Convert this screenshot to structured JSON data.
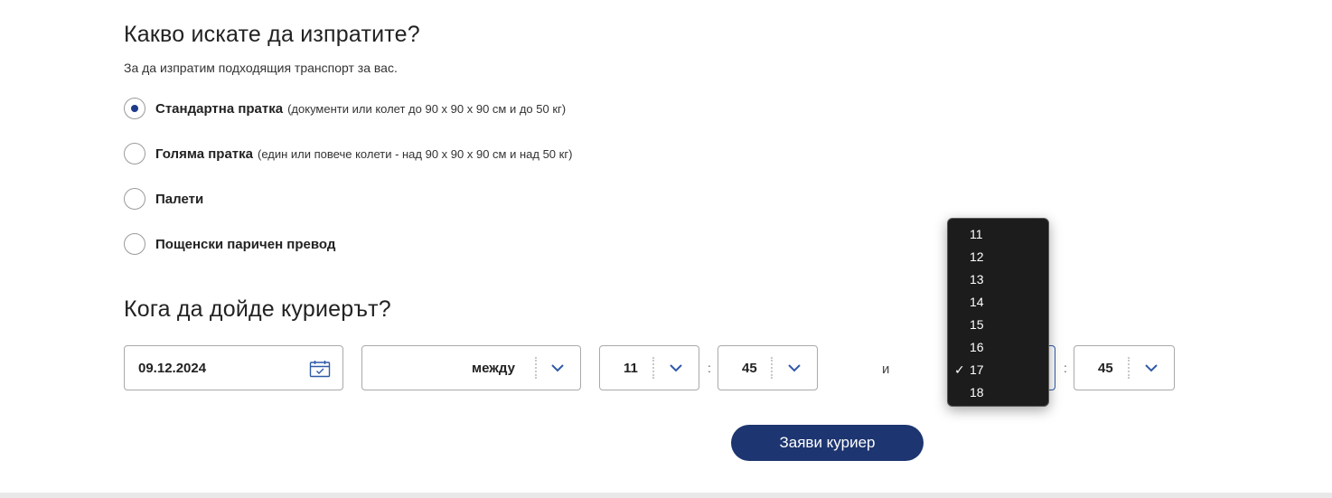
{
  "shipment": {
    "title": "Какво искате да изпратите?",
    "subtitle": "За да изпратим подходящия транспорт за вас.",
    "options": [
      {
        "label": "Стандартна пратка",
        "hint": "(документи или колет до 90 х 90 х 90 см и до 50 кг)",
        "selected": true
      },
      {
        "label": "Голяма пратка",
        "hint": "(един или повече колети - над 90 х 90 х 90 см и над 50 кг)",
        "selected": false
      },
      {
        "label": "Палети",
        "hint": "",
        "selected": false
      },
      {
        "label": "Пощенски паричен превод",
        "hint": "",
        "selected": false
      }
    ]
  },
  "courier": {
    "title": "Кога да дойде куриерът?",
    "date": "09.12.2024",
    "range_mode": "между",
    "from_hour": "11",
    "from_minute": "45",
    "and_label": "и",
    "to_minute": "45",
    "submit_label": "Заяви куриер"
  },
  "hour_dropdown": {
    "options": [
      "11",
      "12",
      "13",
      "14",
      "15",
      "16",
      "17",
      "18"
    ],
    "selected": "17",
    "check_glyph": "✓"
  },
  "colors": {
    "accent": "#1e3a8a",
    "button": "#1d3570",
    "dropdown_bg": "#1c1c1c"
  },
  "icons": [
    "calendar-icon",
    "chevron-down-icon",
    "checkmark-icon"
  ]
}
